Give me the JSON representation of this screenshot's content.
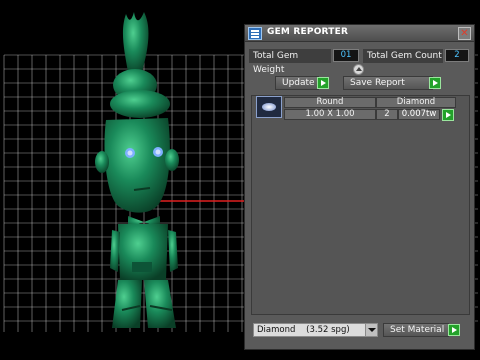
{
  "panel": {
    "title": "GEM REPORTER",
    "close_glyph": "✕",
    "total_weight_label": "Total Gem Weight",
    "total_weight_value": "01",
    "total_count_label": "Total Gem Count",
    "total_count_value": "2",
    "update_label": "Update",
    "save_report_label": "Save Report",
    "table": {
      "header": {
        "shape": "Round",
        "material": "Diamond"
      },
      "row": {
        "size": "1.00 X 1.00",
        "count": "2",
        "weight": "0.007tw"
      }
    },
    "material_select_value": "Diamond    (3.52 spg)",
    "set_material_label": "Set Material"
  },
  "colors": {
    "figure_green": "#1a7a52",
    "grid_line": "#d9d9d9",
    "axis_red": "#e02020",
    "value_blue": "#4dc4ff",
    "go_green": "#23a22a"
  },
  "icons": [
    "gem-reporter-app-icon",
    "close-icon",
    "expand-icon",
    "go-arrow-icon",
    "gem-thumbnail-icon",
    "dropdown-arrow-icon"
  ]
}
